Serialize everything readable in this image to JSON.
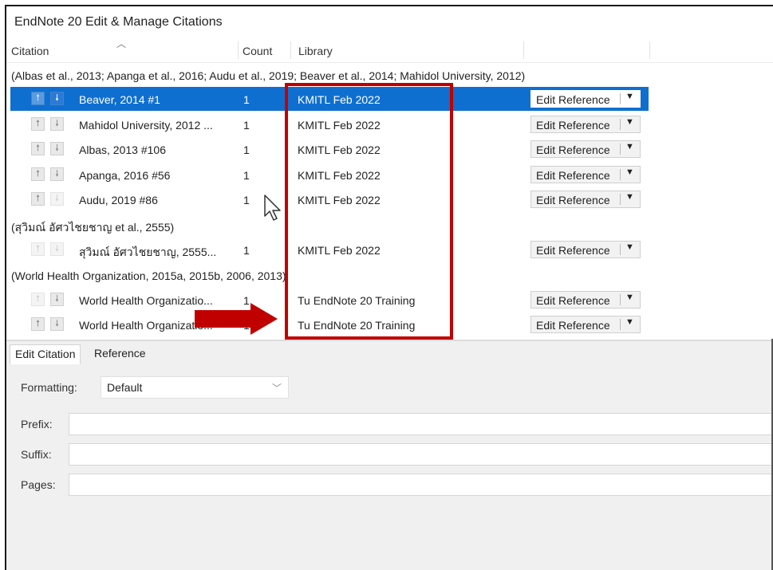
{
  "window": {
    "title": "EndNote 20 Edit & Manage Citations"
  },
  "columns": {
    "citation": "Citation",
    "count": "Count",
    "library": "Library"
  },
  "groups": [
    {
      "label": "(Albas et al., 2013; Apanga et al., 2016; Audu et al., 2019; Beaver et al., 2014; Mahidol University, 2012)",
      "rows": [
        {
          "name": "Beaver, 2014 #1",
          "count": "1",
          "library": "KMITL Feb 2022",
          "selected": true,
          "up_enabled": false,
          "down_enabled": true
        },
        {
          "name": "Mahidol University, 2012 ...",
          "count": "1",
          "library": "KMITL Feb 2022",
          "selected": false,
          "up_enabled": true,
          "down_enabled": true
        },
        {
          "name": "Albas, 2013 #106",
          "count": "1",
          "library": "KMITL Feb 2022",
          "selected": false,
          "up_enabled": true,
          "down_enabled": true
        },
        {
          "name": "Apanga, 2016 #56",
          "count": "1",
          "library": "KMITL Feb 2022",
          "selected": false,
          "up_enabled": true,
          "down_enabled": true
        },
        {
          "name": "Audu, 2019 #86",
          "count": "1",
          "library": "KMITL Feb 2022",
          "selected": false,
          "up_enabled": true,
          "down_enabled": false
        }
      ]
    },
    {
      "label": "(สุวิมณ์ อัศวไชยชาญ et al., 2555)",
      "rows": [
        {
          "name": "สุวิมณ์ อัศวไชยชาญ, 2555...",
          "count": "1",
          "library": "KMITL Feb 2022",
          "selected": false,
          "up_enabled": false,
          "down_enabled": false
        }
      ]
    },
    {
      "label": "(World Health Organization, 2015a, 2015b, 2006, 2013)",
      "rows": [
        {
          "name": "World Health Organizatio...",
          "count": "1",
          "library": "Tu EndNote 20 Training",
          "selected": false,
          "up_enabled": false,
          "down_enabled": true
        },
        {
          "name": "World Health Organizatio...",
          "count": "1",
          "library": "Tu EndNote 20 Training",
          "selected": false,
          "up_enabled": true,
          "down_enabled": true
        }
      ]
    }
  ],
  "edit_reference_label": "Edit Reference",
  "bottom": {
    "tabs": [
      "Edit Citation",
      "Reference"
    ],
    "formatting_label": "Formatting:",
    "formatting_value": "Default",
    "prefix_label": "Prefix:",
    "suffix_label": "Suffix:",
    "pages_label": "Pages:"
  },
  "colors": {
    "selection": "#0f6fd0",
    "annotation_red": "#c00000"
  },
  "icons": [
    "move-up-icon",
    "move-down-icon",
    "dropdown-caret-icon",
    "mouse-cursor-icon",
    "annotation-arrow-icon"
  ]
}
